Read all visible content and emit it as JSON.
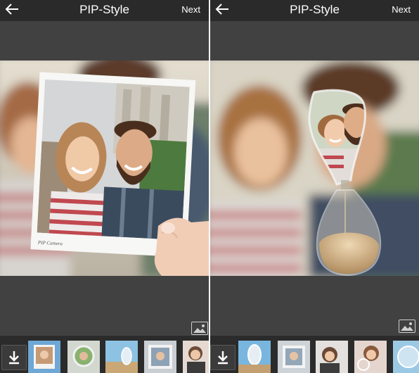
{
  "screens": [
    {
      "header": {
        "title": "PIP-Style",
        "next_label": "Next"
      },
      "frame": {
        "caption": "PIP Camera"
      }
    },
    {
      "header": {
        "title": "PIP-Style",
        "next_label": "Next"
      }
    }
  ],
  "icons": {
    "back": "arrow-left-icon",
    "gallery": "image-gallery-icon",
    "download": "download-icon"
  },
  "colors": {
    "header_bg": "#2a2a2a",
    "canvas_bg": "#414141",
    "toolbar_bg": "#2b2b2b",
    "selected_accent": "#4fb0e6"
  }
}
